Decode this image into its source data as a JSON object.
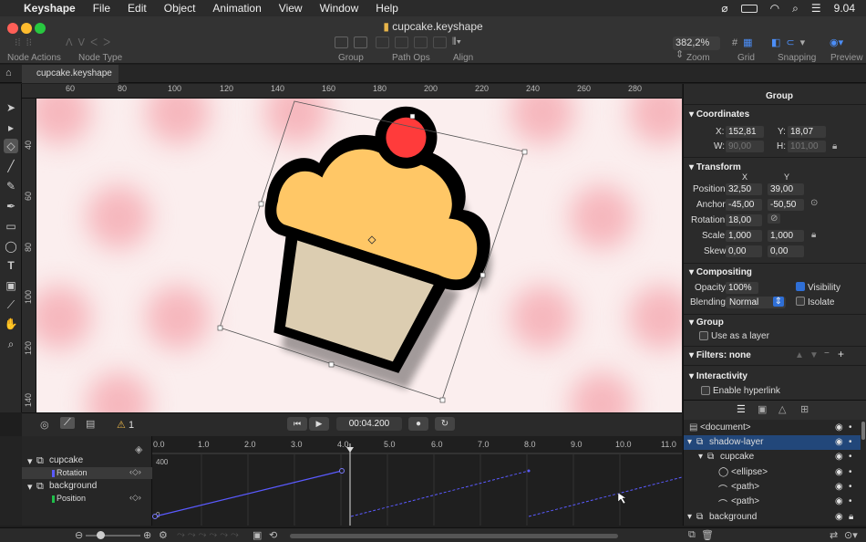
{
  "menubar": {
    "app_name": "Keyshape",
    "items": [
      "File",
      "Edit",
      "Object",
      "Animation",
      "View",
      "Window",
      "Help"
    ],
    "clock": "9.04"
  },
  "window": {
    "title": "cupcake.keyshape",
    "toolbar_labels": {
      "node_actions": "Node Actions",
      "node_type": "Node Type",
      "group": "Group",
      "path_ops": "Path Ops",
      "align": "Align",
      "zoom": "Zoom",
      "grid": "Grid",
      "snapping": "Snapping",
      "preview": "Preview"
    },
    "zoom_value": "382,2%"
  },
  "tab": {
    "label": "cupcake.keyshape"
  },
  "ruler": {
    "h_ticks": [
      "60",
      "80",
      "100",
      "120",
      "140",
      "160",
      "180",
      "200",
      "220",
      "240",
      "260",
      "280"
    ],
    "v_ticks": [
      "40",
      "60",
      "80",
      "100",
      "120",
      "140"
    ]
  },
  "inspector": {
    "header": "Group",
    "coordinates": {
      "title": "Coordinates",
      "x_label": "X:",
      "x_value": "152,81",
      "y_label": "Y:",
      "y_value": "18,07",
      "w_label": "W:",
      "w_value": "90,00",
      "h_label": "H:",
      "h_value": "101,00"
    },
    "transform": {
      "title": "Transform",
      "col_x": "X",
      "col_y": "Y",
      "position_label": "Position:",
      "position_x": "32,50",
      "position_y": "39,00",
      "anchor_label": "Anchor:",
      "anchor_x": "-45,00",
      "anchor_y": "-50,50",
      "rotation_label": "Rotation:",
      "rotation_value": "18,00",
      "scale_label": "Scale:",
      "scale_x": "1,000",
      "scale_y": "1,000",
      "skew_label": "Skew:",
      "skew_x": "0,00",
      "skew_y": "0,00"
    },
    "compositing": {
      "title": "Compositing",
      "opacity_label": "Opacity:",
      "opacity_value": "100%",
      "visibility_label": "Visibility",
      "blending_label": "Blending:",
      "blending_value": "Normal",
      "isolate_label": "Isolate"
    },
    "group_section": {
      "title": "Group",
      "use_as_layer": "Use as a layer"
    },
    "filters": {
      "title": "Filters: none"
    },
    "interactivity": {
      "title": "Interactivity",
      "enable_hyperlink": "Enable hyperlink"
    }
  },
  "layers": [
    {
      "label": "<document>",
      "indent": 0
    },
    {
      "label": "shadow-layer",
      "indent": 0,
      "selected": true
    },
    {
      "label": "cupcake",
      "indent": 1
    },
    {
      "label": "<ellipse>",
      "indent": 2
    },
    {
      "label": "<path>",
      "indent": 2
    },
    {
      "label": "<path>",
      "indent": 2
    },
    {
      "label": "background",
      "indent": 0
    }
  ],
  "timeline": {
    "warning_count": "1",
    "time": "00:04.200",
    "ruler_ticks": [
      "0.0",
      "1.0",
      "2.0",
      "3.0",
      "4.0",
      "5.0",
      "6.0",
      "7.0",
      "8.0",
      "9.0",
      "10.0",
      "11.0"
    ],
    "value_label_top": "400",
    "value_label_bottom": "0",
    "tracks": [
      {
        "name": "cupcake",
        "type": "group"
      },
      {
        "name": "Rotation",
        "type": "property",
        "color": "#5a5aff"
      },
      {
        "name": "background",
        "type": "group"
      },
      {
        "name": "Position",
        "type": "property",
        "color": "#1fbf4a"
      }
    ]
  },
  "colors": {
    "accent_blue": "#2f6fd6",
    "cherry": "#ff3b3b",
    "frosting": "#ffc766",
    "wrapper": "#dccdb1",
    "outline": "#000000",
    "selection": "#22477a"
  }
}
